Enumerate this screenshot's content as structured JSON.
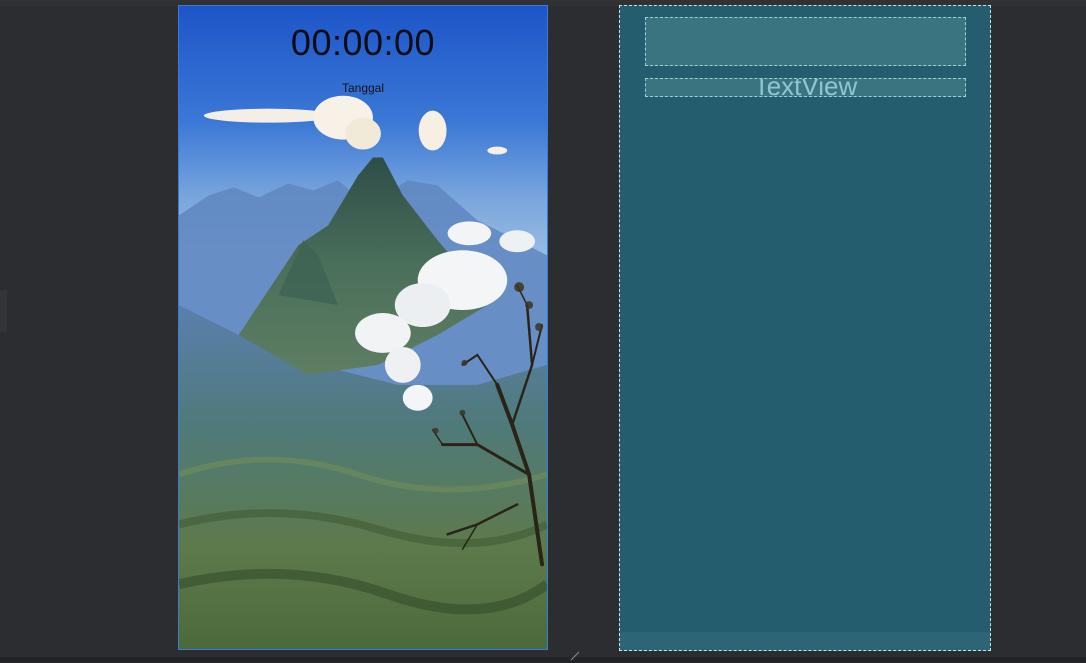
{
  "design_preview": {
    "clock_text": "00:00:00",
    "date_label": "Tanggal",
    "background_image": "mountain-landscape"
  },
  "blueprint_preview": {
    "textview_label": "TextView"
  },
  "colors": {
    "editor_background": "#2b2d30",
    "selection_outline": "#3a7bd5",
    "blueprint_background": "#245e6e",
    "blueprint_widget": "#3a7481",
    "blueprint_text": "#8ec7d2"
  }
}
